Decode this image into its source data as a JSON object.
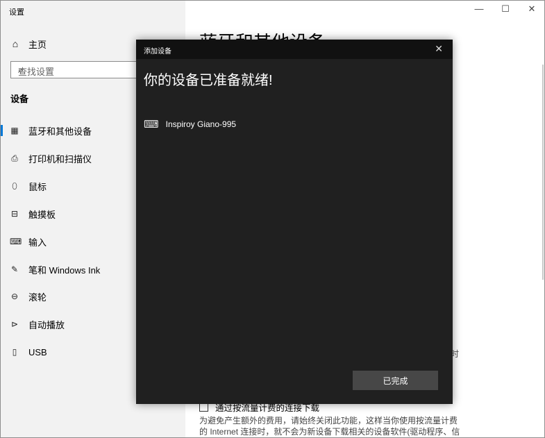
{
  "window": {
    "title": "设置",
    "controls": {
      "minimize": "—",
      "maximize": "☐",
      "close": "✕"
    }
  },
  "sidebar": {
    "home": {
      "icon": "home-icon",
      "glyph": "⌂",
      "label": "主页"
    },
    "search": {
      "placeholder": "查找设置",
      "icon": "search-icon",
      "glyph": "⌕"
    },
    "section_title": "设备",
    "items": [
      {
        "label": "蓝牙和其他设备",
        "icon": "bluetooth-devices-icon",
        "glyph": "▦",
        "active": true
      },
      {
        "label": "打印机和扫描仪",
        "icon": "printer-icon",
        "glyph": "⎙",
        "active": false
      },
      {
        "label": "鼠标",
        "icon": "mouse-icon",
        "glyph": "⬯",
        "active": false
      },
      {
        "label": "触摸板",
        "icon": "touchpad-icon",
        "glyph": "⊟",
        "active": false
      },
      {
        "label": "输入",
        "icon": "keyboard-icon",
        "glyph": "⌨",
        "active": false
      },
      {
        "label": "笔和 Windows Ink",
        "icon": "pen-icon",
        "glyph": "✎",
        "active": false
      },
      {
        "label": "滚轮",
        "icon": "wheel-icon",
        "glyph": "⊖",
        "active": false
      },
      {
        "label": "自动播放",
        "icon": "autoplay-icon",
        "glyph": "⊳",
        "active": false
      },
      {
        "label": "USB",
        "icon": "usb-icon",
        "glyph": "▯",
        "active": false
      }
    ]
  },
  "content": {
    "page_title": "蓝牙和其他设备",
    "partial_text": "时",
    "metered": {
      "label": "通过按流量计费的连接下载",
      "description": "为避免产生额外的费用，请始终关闭此功能，这样当你使用按流量计费的 Internet 连接时，就不会为新设备下载相关的设备软件(驱动程序、信息"
    }
  },
  "dialog": {
    "title": "添加设备",
    "close_glyph": "✕",
    "heading": "你的设备已准备就绪!",
    "device": {
      "name": "Inspiroy Giano-995",
      "icon": "keyboard-device-icon",
      "glyph": "⌨"
    },
    "done_button": "已完成"
  },
  "colors": {
    "accent": "#0078d7",
    "dialog_bg": "#202020",
    "dialog_titlebar": "#111111",
    "button_bg": "#474747"
  }
}
